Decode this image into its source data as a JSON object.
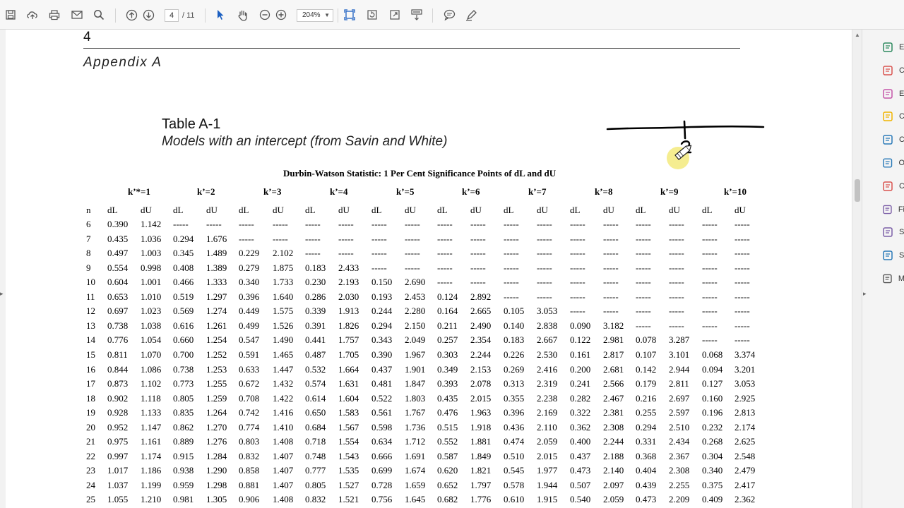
{
  "toolbar": {
    "page_current": "4",
    "page_total": "/ 11",
    "zoom": "204%"
  },
  "right_pane": {
    "items": [
      {
        "label": "E",
        "icon": "export-pdf-icon",
        "color": "#2d8a5e"
      },
      {
        "label": "C",
        "icon": "create-pdf-icon",
        "color": "#d9534f"
      },
      {
        "label": "E",
        "icon": "edit-pdf-icon",
        "color": "#c455a8"
      },
      {
        "label": "C",
        "icon": "comment-icon",
        "color": "#f0b400"
      },
      {
        "label": "C",
        "icon": "combine-files-icon",
        "color": "#2a7ab8"
      },
      {
        "label": "O",
        "icon": "organize-pages-icon",
        "color": "#2a7ab8"
      },
      {
        "label": "C",
        "icon": "compress-pdf-icon",
        "color": "#d9534f"
      },
      {
        "label": "Fi",
        "icon": "fill-sign-icon",
        "color": "#7b5ea7"
      },
      {
        "label": "S",
        "icon": "send-for-signature-icon",
        "color": "#7b5ea7"
      },
      {
        "label": "S",
        "icon": "send-icon",
        "color": "#2a7ab8"
      },
      {
        "label": "M",
        "icon": "more-tools-icon",
        "color": "#555555"
      }
    ]
  },
  "document": {
    "page_number": "4",
    "appendix": "Appendix A",
    "table_title": "Table A-1",
    "table_subtitle": "Models with an intercept (from Savin and White)",
    "dw_title": "Durbin-Watson Statistic: 1 Per Cent Significance Points of dL and dU",
    "k_headers": [
      "k’*=1",
      "k’=2",
      "k’=3",
      "k’=4",
      "k’=5",
      "k’=6",
      "k’=7",
      "k’=8",
      "k’=9",
      "k’=10"
    ],
    "col_headers": [
      "n",
      "dL",
      "dU",
      "dL",
      "dU",
      "dL",
      "dU",
      "dL",
      "dU",
      "dL",
      "dU",
      "dL",
      "dU",
      "dL",
      "dU",
      "dL",
      "dU",
      "dL",
      "dU",
      "dL",
      "dU"
    ],
    "rows": [
      [
        "6",
        "0.390",
        "1.142",
        "-----",
        "-----",
        "-----",
        "-----",
        "-----",
        "-----",
        "-----",
        "-----",
        "-----",
        "-----",
        "-----",
        "-----",
        "-----",
        "-----",
        "-----",
        "-----",
        "-----",
        "-----"
      ],
      [
        "7",
        "0.435",
        "1.036",
        "0.294",
        "1.676",
        "-----",
        "-----",
        "-----",
        "-----",
        "-----",
        "-----",
        "-----",
        "-----",
        "-----",
        "-----",
        "-----",
        "-----",
        "-----",
        "-----",
        "-----",
        "-----"
      ],
      [
        "8",
        "0.497",
        "1.003",
        "0.345",
        "1.489",
        "0.229",
        "2.102",
        "-----",
        "-----",
        "-----",
        "-----",
        "-----",
        "-----",
        "-----",
        "-----",
        "-----",
        "-----",
        "-----",
        "-----",
        "-----",
        "-----"
      ],
      [
        "9",
        "0.554",
        "0.998",
        "0.408",
        "1.389",
        "0.279",
        "1.875",
        "0.183",
        "2.433",
        "-----",
        "-----",
        "-----",
        "-----",
        "-----",
        "-----",
        "-----",
        "-----",
        "-----",
        "-----",
        "-----",
        "-----"
      ],
      [
        "10",
        "0.604",
        "1.001",
        "0.466",
        "1.333",
        "0.340",
        "1.733",
        "0.230",
        "2.193",
        "0.150",
        "2.690",
        "-----",
        "-----",
        "-----",
        "-----",
        "-----",
        "-----",
        "-----",
        "-----",
        "-----",
        "-----"
      ],
      [
        "11",
        "0.653",
        "1.010",
        "0.519",
        "1.297",
        "0.396",
        "1.640",
        "0.286",
        "2.030",
        "0.193",
        "2.453",
        "0.124",
        "2.892",
        "-----",
        "-----",
        "-----",
        "-----",
        "-----",
        "-----",
        "-----",
        "-----"
      ],
      [
        "12",
        "0.697",
        "1.023",
        "0.569",
        "1.274",
        "0.449",
        "1.575",
        "0.339",
        "1.913",
        "0.244",
        "2.280",
        "0.164",
        "2.665",
        "0.105",
        "3.053",
        "-----",
        "-----",
        "-----",
        "-----",
        "-----",
        "-----"
      ],
      [
        "13",
        "0.738",
        "1.038",
        "0.616",
        "1.261",
        "0.499",
        "1.526",
        "0.391",
        "1.826",
        "0.294",
        "2.150",
        "0.211",
        "2.490",
        "0.140",
        "2.838",
        "0.090",
        "3.182",
        "-----",
        "-----",
        "-----",
        "-----"
      ],
      [
        "14",
        "0.776",
        "1.054",
        "0.660",
        "1.254",
        "0.547",
        "1.490",
        "0.441",
        "1.757",
        "0.343",
        "2.049",
        "0.257",
        "2.354",
        "0.183",
        "2.667",
        "0.122",
        "2.981",
        "0.078",
        "3.287",
        "-----",
        "-----"
      ],
      [
        "15",
        "0.811",
        "1.070",
        "0.700",
        "1.252",
        "0.591",
        "1.465",
        "0.487",
        "1.705",
        "0.390",
        "1.967",
        "0.303",
        "2.244",
        "0.226",
        "2.530",
        "0.161",
        "2.817",
        "0.107",
        "3.101",
        "0.068",
        "3.374"
      ],
      [
        "16",
        "0.844",
        "1.086",
        "0.738",
        "1.253",
        "0.633",
        "1.447",
        "0.532",
        "1.664",
        "0.437",
        "1.901",
        "0.349",
        "2.153",
        "0.269",
        "2.416",
        "0.200",
        "2.681",
        "0.142",
        "2.944",
        "0.094",
        "3.201"
      ],
      [
        "17",
        "0.873",
        "1.102",
        "0.773",
        "1.255",
        "0.672",
        "1.432",
        "0.574",
        "1.631",
        "0.481",
        "1.847",
        "0.393",
        "2.078",
        "0.313",
        "2.319",
        "0.241",
        "2.566",
        "0.179",
        "2.811",
        "0.127",
        "3.053"
      ],
      [
        "18",
        "0.902",
        "1.118",
        "0.805",
        "1.259",
        "0.708",
        "1.422",
        "0.614",
        "1.604",
        "0.522",
        "1.803",
        "0.435",
        "2.015",
        "0.355",
        "2.238",
        "0.282",
        "2.467",
        "0.216",
        "2.697",
        "0.160",
        "2.925"
      ],
      [
        "19",
        "0.928",
        "1.133",
        "0.835",
        "1.264",
        "0.742",
        "1.416",
        "0.650",
        "1.583",
        "0.561",
        "1.767",
        "0.476",
        "1.963",
        "0.396",
        "2.169",
        "0.322",
        "2.381",
        "0.255",
        "2.597",
        "0.196",
        "2.813"
      ],
      [
        "20",
        "0.952",
        "1.147",
        "0.862",
        "1.270",
        "0.774",
        "1.410",
        "0.684",
        "1.567",
        "0.598",
        "1.736",
        "0.515",
        "1.918",
        "0.436",
        "2.110",
        "0.362",
        "2.308",
        "0.294",
        "2.510",
        "0.232",
        "2.174"
      ],
      [
        "21",
        "0.975",
        "1.161",
        "0.889",
        "1.276",
        "0.803",
        "1.408",
        "0.718",
        "1.554",
        "0.634",
        "1.712",
        "0.552",
        "1.881",
        "0.474",
        "2.059",
        "0.400",
        "2.244",
        "0.331",
        "2.434",
        "0.268",
        "2.625"
      ],
      [
        "22",
        "0.997",
        "1.174",
        "0.915",
        "1.284",
        "0.832",
        "1.407",
        "0.748",
        "1.543",
        "0.666",
        "1.691",
        "0.587",
        "1.849",
        "0.510",
        "2.015",
        "0.437",
        "2.188",
        "0.368",
        "2.367",
        "0.304",
        "2.548"
      ],
      [
        "23",
        "1.017",
        "1.186",
        "0.938",
        "1.290",
        "0.858",
        "1.407",
        "0.777",
        "1.535",
        "0.699",
        "1.674",
        "0.620",
        "1.821",
        "0.545",
        "1.977",
        "0.473",
        "2.140",
        "0.404",
        "2.308",
        "0.340",
        "2.479"
      ],
      [
        "24",
        "1.037",
        "1.199",
        "0.959",
        "1.298",
        "0.881",
        "1.407",
        "0.805",
        "1.527",
        "0.728",
        "1.659",
        "0.652",
        "1.797",
        "0.578",
        "1.944",
        "0.507",
        "2.097",
        "0.439",
        "2.255",
        "0.375",
        "2.417"
      ],
      [
        "25",
        "1.055",
        "1.210",
        "0.981",
        "1.305",
        "0.906",
        "1.408",
        "0.832",
        "1.521",
        "0.756",
        "1.645",
        "0.682",
        "1.776",
        "0.610",
        "1.915",
        "0.540",
        "2.059",
        "0.473",
        "2.209",
        "0.409",
        "2.362"
      ]
    ]
  },
  "annotation": {
    "handwritten_digit": "2",
    "pen_color": "#000000",
    "cursor_highlight": "#f5e97a"
  }
}
